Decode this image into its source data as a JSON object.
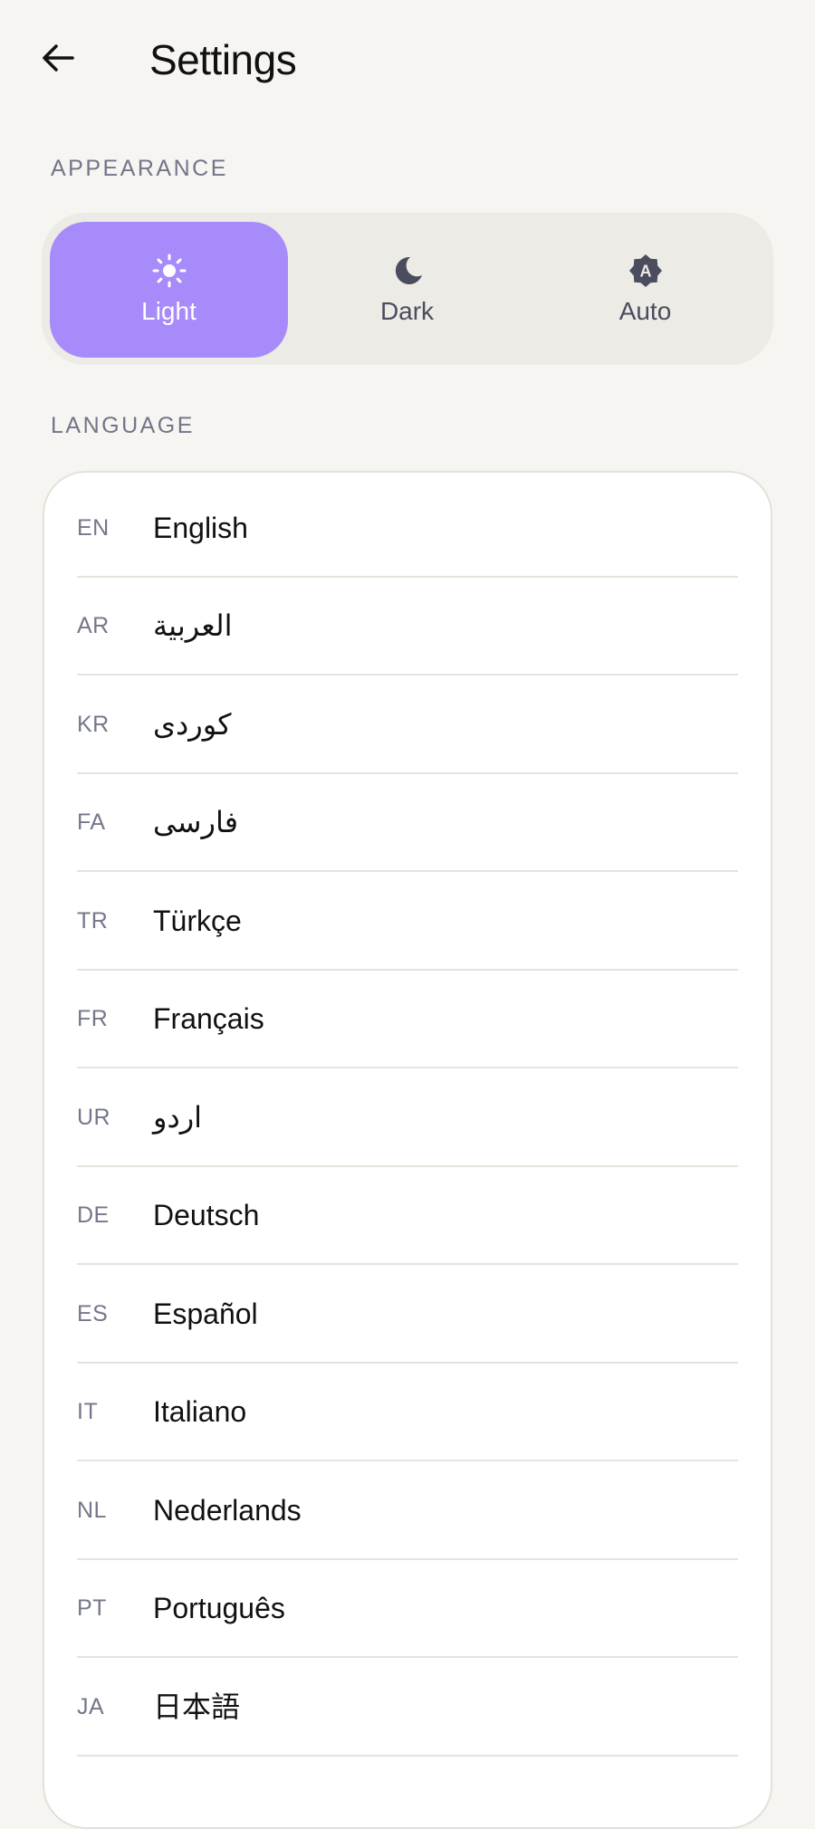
{
  "header": {
    "title": "Settings",
    "back_icon": "arrow-left-icon"
  },
  "appearance": {
    "section_label": "APPEARANCE",
    "selected": "Light",
    "options": [
      {
        "label": "Light",
        "icon": "sun-icon"
      },
      {
        "label": "Dark",
        "icon": "moon-icon"
      },
      {
        "label": "Auto",
        "icon": "auto-brightness-icon",
        "icon_letter": "A"
      }
    ],
    "accent_color": "#a78bfa"
  },
  "language": {
    "section_label": "LANGUAGE",
    "items": [
      {
        "code": "EN",
        "name": "English"
      },
      {
        "code": "AR",
        "name": "العربية"
      },
      {
        "code": "KR",
        "name": "کوردی"
      },
      {
        "code": "FA",
        "name": "فارسی"
      },
      {
        "code": "TR",
        "name": "Türkçe"
      },
      {
        "code": "FR",
        "name": "Français"
      },
      {
        "code": "UR",
        "name": "اردو"
      },
      {
        "code": "DE",
        "name": "Deutsch"
      },
      {
        "code": "ES",
        "name": "Español"
      },
      {
        "code": "IT",
        "name": "Italiano"
      },
      {
        "code": "NL",
        "name": "Nederlands"
      },
      {
        "code": "PT",
        "name": "Português"
      },
      {
        "code": "JA",
        "name": "日本語"
      }
    ]
  }
}
